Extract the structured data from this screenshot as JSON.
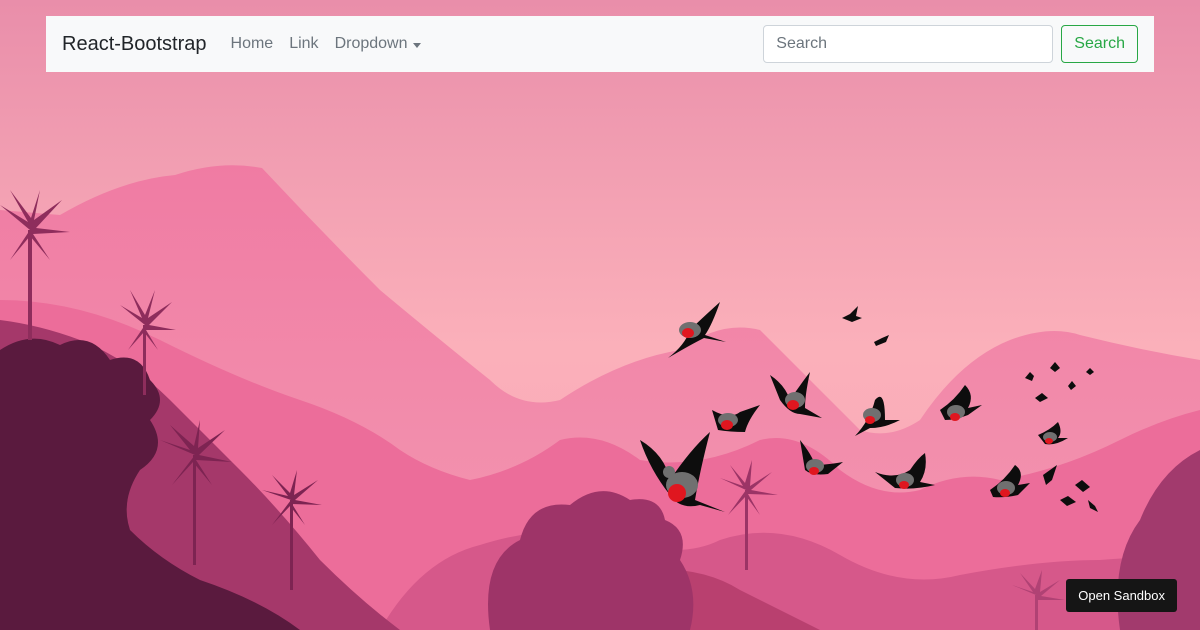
{
  "navbar": {
    "brand": "React-Bootstrap",
    "links": [
      {
        "label": "Home"
      },
      {
        "label": "Link"
      },
      {
        "label": "Dropdown"
      }
    ],
    "search": {
      "placeholder": "Search",
      "value": "",
      "button_label": "Search"
    }
  },
  "sandbox_button": {
    "label": "Open Sandbox"
  },
  "colors": {
    "sky_top": "#e98eaa",
    "sky_bottom": "#fbb0ba",
    "navbar_bg": "#f8f9fa",
    "search_button": "#28a745",
    "sandbox_button_bg": "#151515"
  },
  "background": {
    "scene": "pink-mountain-landscape",
    "icons": [
      "mountain-icon",
      "palm-tree-icon",
      "bird-icon"
    ]
  }
}
